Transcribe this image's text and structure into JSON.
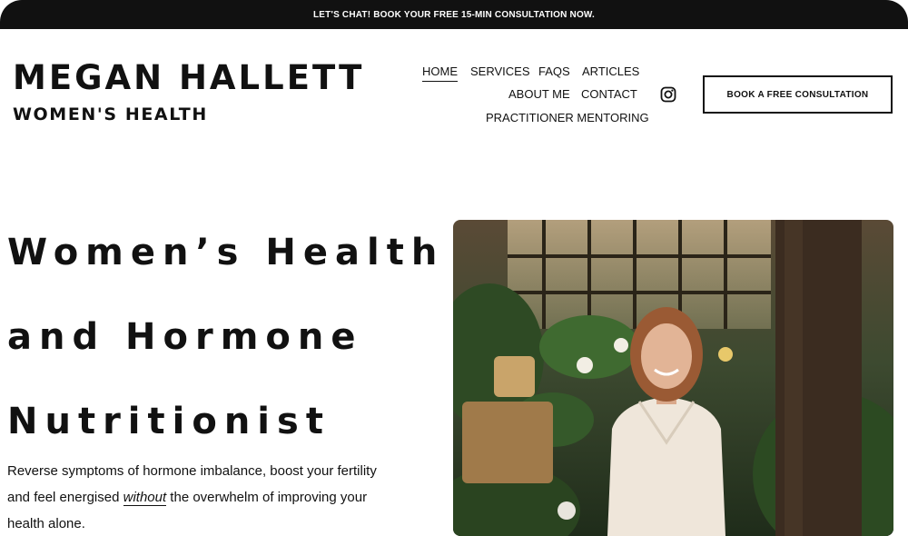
{
  "announcement": {
    "text": "LET'S CHAT! BOOK YOUR FREE 15-MIN CONSULTATION NOW."
  },
  "brand": {
    "name": "MEGAN HALLETT",
    "subtitle": "WOMEN'S HEALTH"
  },
  "nav": {
    "home": "HOME",
    "services": "SERVICES",
    "faqs": "FAQS",
    "articles": "ARTICLES",
    "about": "ABOUT ME",
    "contact": "CONTACT",
    "mentoring": "PRACTITIONER MENTORING",
    "active": "HOME"
  },
  "social": {
    "icon": "instagram-icon"
  },
  "cta": {
    "label": "BOOK A FREE CONSULTATION"
  },
  "hero": {
    "title_line1": "Women’s Health",
    "title_line2": "and Hormone",
    "title_line3": "Nutritionist",
    "text_before": "Reverse symptoms of hormone imbalance, boost your fertility and feel energised ",
    "text_emphasis": "without",
    "text_after": " the overwhelm of improving your health alone."
  },
  "colors": {
    "dark": "#111111",
    "background": "#ffffff",
    "photo_green": "#2f4a2a"
  }
}
